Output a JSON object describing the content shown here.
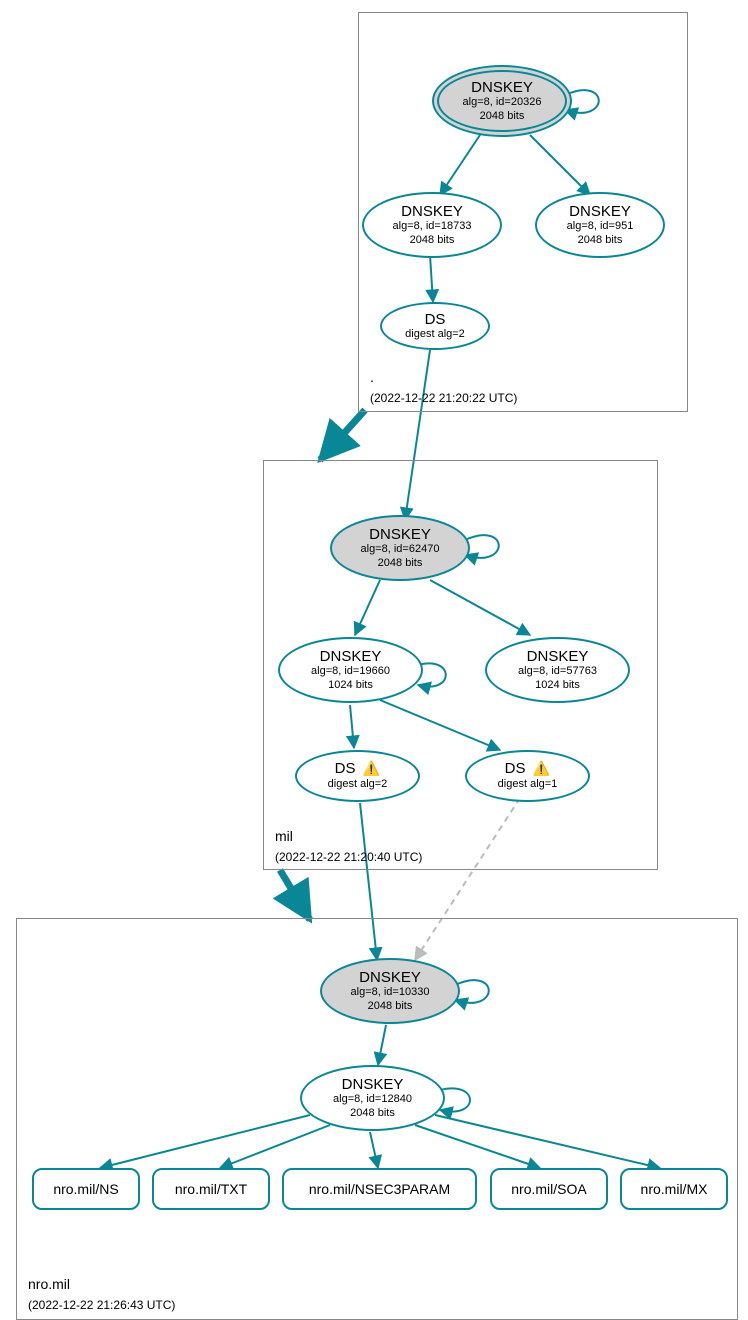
{
  "zones": {
    "root": {
      "name": ".",
      "timestamp": "(2022-12-22 21:20:22 UTC)"
    },
    "mil": {
      "name": "mil",
      "timestamp": "(2022-12-22 21:20:40 UTC)"
    },
    "nro": {
      "name": "nro.mil",
      "timestamp": "(2022-12-22 21:26:43 UTC)"
    }
  },
  "nodes": {
    "root_ksk": {
      "title": "DNSKEY",
      "sub1": "alg=8, id=20326",
      "sub2": "2048 bits"
    },
    "root_zsk1": {
      "title": "DNSKEY",
      "sub1": "alg=8, id=18733",
      "sub2": "2048 bits"
    },
    "root_zsk2": {
      "title": "DNSKEY",
      "sub1": "alg=8, id=951",
      "sub2": "2048 bits"
    },
    "root_ds": {
      "title": "DS",
      "sub1": "digest alg=2"
    },
    "mil_ksk": {
      "title": "DNSKEY",
      "sub1": "alg=8, id=62470",
      "sub2": "2048 bits"
    },
    "mil_zsk1": {
      "title": "DNSKEY",
      "sub1": "alg=8, id=19660",
      "sub2": "1024 bits"
    },
    "mil_zsk2": {
      "title": "DNSKEY",
      "sub1": "alg=8, id=57763",
      "sub2": "1024 bits"
    },
    "mil_ds1": {
      "title": "DS",
      "sub1": "digest alg=2",
      "warn": "⚠️"
    },
    "mil_ds2": {
      "title": "DS",
      "sub1": "digest alg=1",
      "warn": "⚠️"
    },
    "nro_ksk": {
      "title": "DNSKEY",
      "sub1": "alg=8, id=10330",
      "sub2": "2048 bits"
    },
    "nro_zsk": {
      "title": "DNSKEY",
      "sub1": "alg=8, id=12840",
      "sub2": "2048 bits"
    },
    "rr_ns": {
      "label": "nro.mil/NS"
    },
    "rr_txt": {
      "label": "nro.mil/TXT"
    },
    "rr_nsec3": {
      "label": "nro.mil/NSEC3PARAM"
    },
    "rr_soa": {
      "label": "nro.mil/SOA"
    },
    "rr_mx": {
      "label": "nro.mil/MX"
    }
  }
}
